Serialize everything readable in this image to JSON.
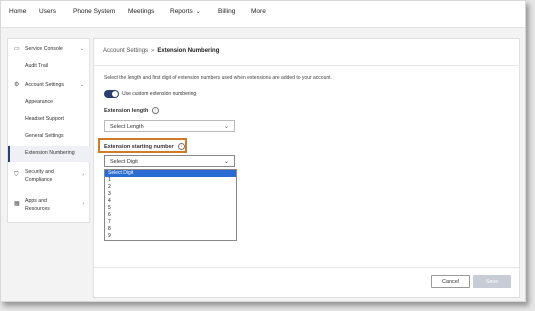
{
  "topnav": {
    "items": [
      {
        "label": "Home"
      },
      {
        "label": "Users"
      },
      {
        "label": "Phone System"
      },
      {
        "label": "Meetings"
      },
      {
        "label": "Reports"
      },
      {
        "label": "Billing"
      },
      {
        "label": "More"
      }
    ]
  },
  "sidebar": {
    "items": [
      {
        "label": "Service Console",
        "icon": "console-icon"
      },
      {
        "label": "Audit Trail"
      },
      {
        "label": "Account Settings",
        "icon": "gear-icon"
      },
      {
        "label": "Appearance"
      },
      {
        "label": "Headset Support"
      },
      {
        "label": "General Settings"
      },
      {
        "label": "Extension Numbering"
      },
      {
        "label_line1": "Security and",
        "label_line2": "Compliance",
        "icon": "shield-icon"
      },
      {
        "label_line1": "Apps and",
        "label_line2": "Resources",
        "icon": "apps-grid-icon"
      }
    ]
  },
  "breadcrumb": {
    "parent": "Account Settings",
    "separator": "»",
    "current": "Extension Numbering"
  },
  "form": {
    "description": "Select the length and first digit of extension numbers used when extensions are added to your account.",
    "toggle_label": "Use custom extension numbering",
    "toggle_on": true,
    "length_label": "Extension length",
    "length_value": "Select Length",
    "start_label": "Extension starting number",
    "start_value": "Select Digit",
    "start_options": [
      "Select Digit",
      "1",
      "2",
      "3",
      "4",
      "5",
      "6",
      "7",
      "8",
      "9"
    ],
    "selected_option": "Select Digit"
  },
  "footer": {
    "cancel_label": "Cancel",
    "save_label": "Save"
  },
  "colors": {
    "accent": "#2a3f6e",
    "highlight": "#d07b2a",
    "selected_option": "#2b6cd4"
  }
}
